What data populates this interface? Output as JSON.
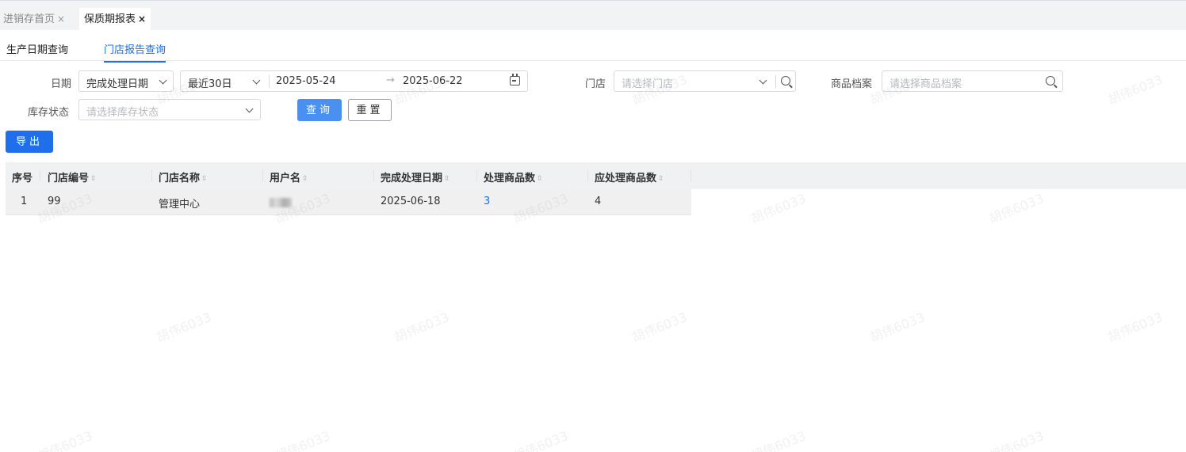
{
  "tabs": [
    {
      "label": "进销存首页",
      "close": "×"
    },
    {
      "label": "保质期报表",
      "close": "×"
    }
  ],
  "subtabs": [
    "生产日期查询",
    "门店报告查询"
  ],
  "form": {
    "date_label": "日期",
    "date_type": "完成处理日期",
    "date_range_preset": "最近30日",
    "date_start": "2025-05-24",
    "date_arrow": "→",
    "date_end": "2025-06-22",
    "store_label": "门店",
    "store_placeholder": "请选择门店",
    "product_label": "商品档案",
    "product_placeholder": "请选择商品档案",
    "stock_label": "库存状态",
    "stock_placeholder": "请选择库存状态",
    "query_button": "查询",
    "reset_button": "重置",
    "export_button": "导出"
  },
  "table": {
    "columns": [
      "序号",
      "门店编号",
      "门店名称",
      "用户名",
      "完成处理日期",
      "处理商品数",
      "应处理商品数"
    ],
    "rows": [
      [
        "1",
        "99",
        "管理中心",
        "",
        "2025-06-18",
        "3",
        "4"
      ]
    ]
  },
  "watermark": "胡伟6033",
  "colors": {
    "accent": "#1f6feb",
    "primary_button": "#4a90f0",
    "header_bg": "#f0f1f3"
  }
}
